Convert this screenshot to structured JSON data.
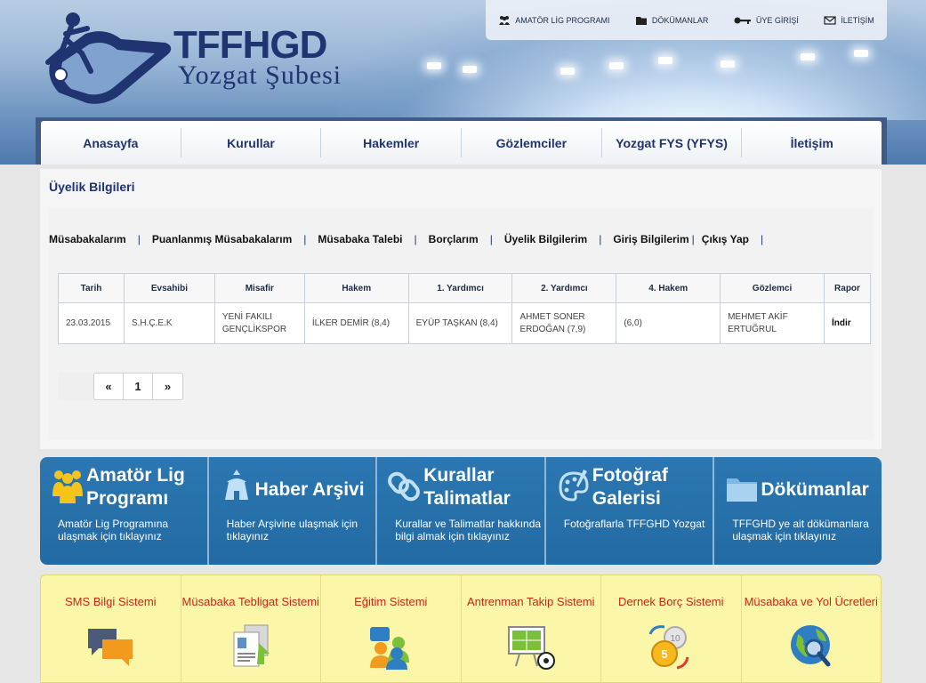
{
  "header": {
    "brand_title": "TFFHGD",
    "brand_subtitle": "Yozgat Şubesi",
    "top_links": [
      {
        "icon": "people-icon",
        "label": "AMATÖR LİG PROGRAMI"
      },
      {
        "icon": "folder-icon",
        "label": "DÖKÜMANLAR"
      },
      {
        "icon": "key-icon",
        "label": "ÜYE GİRİŞİ"
      },
      {
        "icon": "envelope-icon",
        "label": "İLETİŞİM"
      }
    ]
  },
  "nav": {
    "items": [
      "Anasayfa",
      "Kurullar",
      "Hakemler",
      "Gözlemciler",
      "Yozgat FYS (YFYS)",
      "İletişim"
    ]
  },
  "content": {
    "page_title": "Üyelik Bilgileri",
    "submenu": [
      "Müsabakalarım",
      "Puanlanmış Müsabakalarım",
      "Müsabaka Talebi",
      "Borçlarım",
      "Üyelik Bilgilerim",
      "Giriş Bilgilerim",
      "Çıkış Yap"
    ],
    "table": {
      "headers": [
        "Tarih",
        "Evsahibi",
        "Misafir",
        "Hakem",
        "1. Yardımcı",
        "2. Yardımcı",
        "4. Hakem",
        "Gözlemci",
        "Rapor"
      ],
      "rows": [
        [
          "23.03.2015",
          "S.H.Ç.E.K",
          "YENİ FAKILI GENÇLİKSPOR",
          "İLKER DEMİR (8,4)",
          "EYÜP TAŞKAN (8,4)",
          "AHMET SONER ERDOĞAN (7,9)",
          "(6,0)",
          "MEHMET AKİF ERTUĞRUL",
          "İndir"
        ]
      ]
    },
    "pager": {
      "prev": "«",
      "page": "1",
      "next": "»"
    }
  },
  "tiles": [
    {
      "icon": "people-icon",
      "title": "Amatör Lig Programı",
      "desc": "Amatör Lig Programına ulaşmak için tıklayınız"
    },
    {
      "icon": "tent-icon",
      "title": "Haber Arşivi",
      "desc": "Haber Arşivine ulaşmak için tıklayınız"
    },
    {
      "icon": "link-icon",
      "title": "Kurallar Talimatlar",
      "desc": "Kurallar ve Talimatlar hakkında bilgi almak için tıklayınız"
    },
    {
      "icon": "palette-icon",
      "title": "Fotoğraf Galerisi",
      "desc": "Fotoğraflarla TFFGHD Yozgat"
    },
    {
      "icon": "folder-icon",
      "title": "Dökümanlar",
      "desc": "TFFGHD ye ait dökümanlara ulaşmak için tıklayınız"
    }
  ],
  "systems": [
    {
      "icon": "chat-bubbles-icon",
      "label": "SMS Bilgi Sistemi"
    },
    {
      "icon": "documents-icon",
      "label": "Müsabaka Tebligat Sistemi"
    },
    {
      "icon": "users-icon",
      "label": "Eğitim Sistemi"
    },
    {
      "icon": "tactics-board-icon",
      "label": "Antrenman Takip Sistemi"
    },
    {
      "icon": "coins-icon",
      "label": "Dernek Borç Sistemi"
    },
    {
      "icon": "globe-search-icon",
      "label": "Müsabaka ve Yol Ücretleri"
    }
  ],
  "colors": {
    "brand": "#1f3470",
    "tile_blue": "#2a72ad",
    "system_bg": "#fbf6a8",
    "system_text": "#c8271a"
  }
}
